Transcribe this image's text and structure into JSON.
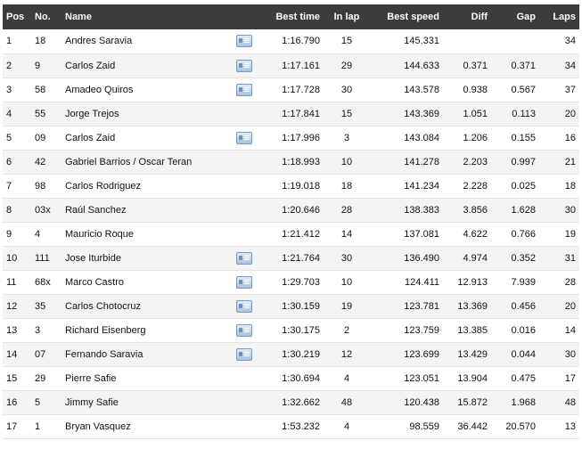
{
  "headers": {
    "pos": "Pos",
    "no": "No.",
    "name": "Name",
    "best_time": "Best time",
    "in_lap": "In lap",
    "best_speed": "Best speed",
    "diff": "Diff",
    "gap": "Gap",
    "laps": "Laps"
  },
  "rows": [
    {
      "pos": "1",
      "no": "18",
      "name": "Andres Saravia",
      "icon": "driver-card-icon",
      "best_time": "1:16.790",
      "in_lap": "15",
      "best_speed": "145.331",
      "diff": "",
      "gap": "",
      "laps": "34"
    },
    {
      "pos": "2",
      "no": "9",
      "name": "Carlos Zaid",
      "icon": "driver-card-icon",
      "best_time": "1:17.161",
      "in_lap": "29",
      "best_speed": "144.633",
      "diff": "0.371",
      "gap": "0.371",
      "laps": "34"
    },
    {
      "pos": "3",
      "no": "58",
      "name": "Amadeo Quiros",
      "icon": "driver-card-icon",
      "best_time": "1:17.728",
      "in_lap": "30",
      "best_speed": "143.578",
      "diff": "0.938",
      "gap": "0.567",
      "laps": "37"
    },
    {
      "pos": "4",
      "no": "55",
      "name": "Jorge Trejos",
      "icon": "",
      "best_time": "1:17.841",
      "in_lap": "15",
      "best_speed": "143.369",
      "diff": "1.051",
      "gap": "0.113",
      "laps": "20"
    },
    {
      "pos": "5",
      "no": "09",
      "name": "Carlos Zaid",
      "icon": "driver-card-icon",
      "best_time": "1:17.996",
      "in_lap": "3",
      "best_speed": "143.084",
      "diff": "1.206",
      "gap": "0.155",
      "laps": "16"
    },
    {
      "pos": "6",
      "no": "42",
      "name": "Gabriel Barrios / Oscar Teran",
      "icon": "",
      "best_time": "1:18.993",
      "in_lap": "10",
      "best_speed": "141.278",
      "diff": "2.203",
      "gap": "0.997",
      "laps": "21"
    },
    {
      "pos": "7",
      "no": "98",
      "name": "Carlos Rodriguez",
      "icon": "",
      "best_time": "1:19.018",
      "in_lap": "18",
      "best_speed": "141.234",
      "diff": "2.228",
      "gap": "0.025",
      "laps": "18"
    },
    {
      "pos": "8",
      "no": "03x",
      "name": "Raúl Sanchez",
      "icon": "",
      "best_time": "1:20.646",
      "in_lap": "28",
      "best_speed": "138.383",
      "diff": "3.856",
      "gap": "1.628",
      "laps": "30"
    },
    {
      "pos": "9",
      "no": "4",
      "name": "Mauricio Roque",
      "icon": "",
      "best_time": "1:21.412",
      "in_lap": "14",
      "best_speed": "137.081",
      "diff": "4.622",
      "gap": "0.766",
      "laps": "19"
    },
    {
      "pos": "10",
      "no": "111",
      "name": "Jose Iturbide",
      "icon": "driver-card-icon",
      "best_time": "1:21.764",
      "in_lap": "30",
      "best_speed": "136.490",
      "diff": "4.974",
      "gap": "0.352",
      "laps": "31"
    },
    {
      "pos": "11",
      "no": "68x",
      "name": "Marco Castro",
      "icon": "driver-card-icon",
      "best_time": "1:29.703",
      "in_lap": "10",
      "best_speed": "124.411",
      "diff": "12.913",
      "gap": "7.939",
      "laps": "28"
    },
    {
      "pos": "12",
      "no": "35",
      "name": "Carlos Chotocruz",
      "icon": "driver-card-icon",
      "best_time": "1:30.159",
      "in_lap": "19",
      "best_speed": "123.781",
      "diff": "13.369",
      "gap": "0.456",
      "laps": "20"
    },
    {
      "pos": "13",
      "no": "3",
      "name": "Richard Eisenberg",
      "icon": "driver-card-icon",
      "best_time": "1:30.175",
      "in_lap": "2",
      "best_speed": "123.759",
      "diff": "13.385",
      "gap": "0.016",
      "laps": "14"
    },
    {
      "pos": "14",
      "no": "07",
      "name": "Fernando Saravia",
      "icon": "driver-card-icon",
      "best_time": "1:30.219",
      "in_lap": "12",
      "best_speed": "123.699",
      "diff": "13.429",
      "gap": "0.044",
      "laps": "30"
    },
    {
      "pos": "15",
      "no": "29",
      "name": "Pierre Safie",
      "icon": "",
      "best_time": "1:30.694",
      "in_lap": "4",
      "best_speed": "123.051",
      "diff": "13.904",
      "gap": "0.475",
      "laps": "17"
    },
    {
      "pos": "16",
      "no": "5",
      "name": "Jimmy Safie",
      "icon": "",
      "best_time": "1:32.662",
      "in_lap": "48",
      "best_speed": "120.438",
      "diff": "15.872",
      "gap": "1.968",
      "laps": "48"
    },
    {
      "pos": "17",
      "no": "1",
      "name": "Bryan Vasquez",
      "icon": "",
      "best_time": "1:53.232",
      "in_lap": "4",
      "best_speed": "98.559",
      "diff": "36.442",
      "gap": "20.570",
      "laps": "13"
    }
  ]
}
